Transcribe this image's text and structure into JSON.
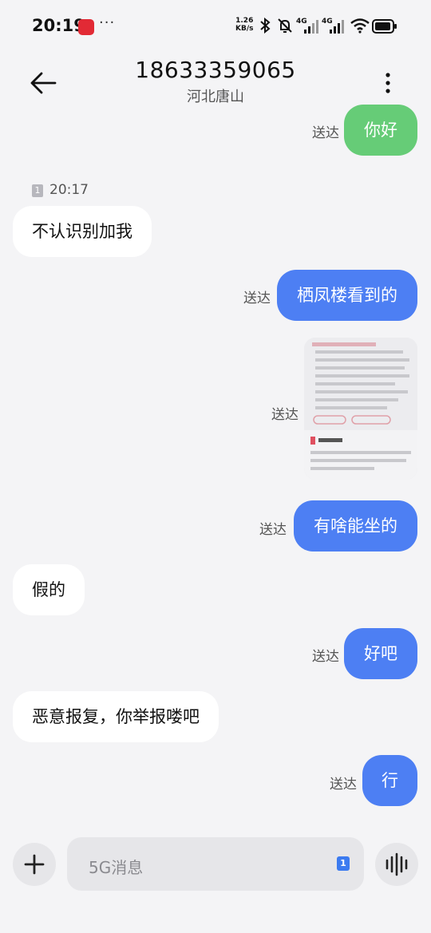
{
  "status_bar": {
    "time": "20:19",
    "more": "···",
    "net_speed_value": "1.26",
    "net_speed_unit": "KB/s",
    "net1": "4G",
    "net2": "4G",
    "icons": [
      "bluetooth-icon",
      "mute-icon",
      "signal-icon",
      "wifi-icon",
      "battery-icon"
    ]
  },
  "header": {
    "title": "18633359065",
    "subtitle": "河北唐山",
    "back_icon": "arrow-left-icon",
    "menu_icon": "more-vertical-icon"
  },
  "conversation": {
    "sent_label": "送达",
    "timestamp": "20:17",
    "sim_badge": "1",
    "messages": [
      {
        "dir": "out",
        "text": "你好"
      },
      {
        "dir": "in",
        "text": "不认识别加我"
      },
      {
        "dir": "out",
        "text": "栖凤楼看到的"
      },
      {
        "dir": "out",
        "type": "image"
      },
      {
        "dir": "out",
        "text": "有啥能坐的"
      },
      {
        "dir": "in",
        "text": "假的"
      },
      {
        "dir": "out",
        "text": "好吧"
      },
      {
        "dir": "in",
        "text": "恶意报复，你举报喽吧"
      },
      {
        "dir": "out",
        "text": "行"
      }
    ]
  },
  "input_bar": {
    "placeholder": "5G消息",
    "sim_label": "1",
    "add_icon": "plus-icon",
    "voice_icon": "voice-wave-icon"
  },
  "colors": {
    "outgoing_bubble": "#4d7ff3",
    "first_bubble": "#66cc77",
    "incoming_bubble": "#ffffff",
    "background": "#f4f4f6"
  }
}
